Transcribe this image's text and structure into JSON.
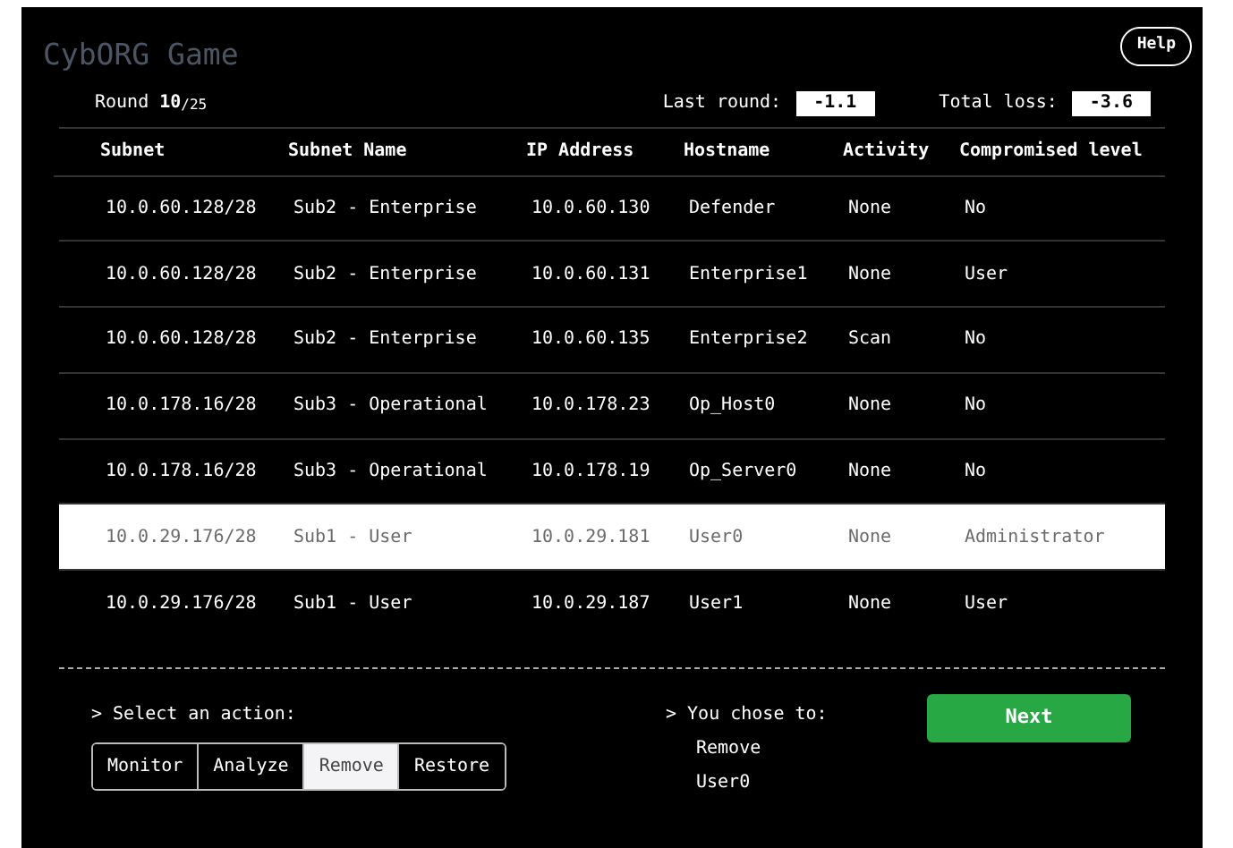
{
  "title": "CybORG Game",
  "help_button": "Help",
  "round": {
    "label": "Round",
    "current": "10",
    "total": "/25"
  },
  "scores": [
    {
      "label": "Last round:",
      "value": "-1.1"
    },
    {
      "label": "Total loss:",
      "value": "-3.6"
    }
  ],
  "table": {
    "columns": [
      "Subnet",
      "Subnet Name",
      "IP Address",
      "Hostname",
      "Activity",
      "Compromised level"
    ],
    "rows": [
      {
        "cells": [
          "10.0.60.128/28",
          "Sub2 - Enterprise",
          "10.0.60.130",
          "Defender",
          "None",
          "No"
        ],
        "selected": false
      },
      {
        "cells": [
          "10.0.60.128/28",
          "Sub2 - Enterprise",
          "10.0.60.131",
          "Enterprise1",
          "None",
          "User"
        ],
        "selected": false
      },
      {
        "cells": [
          "10.0.60.128/28",
          "Sub2 - Enterprise",
          "10.0.60.135",
          "Enterprise2",
          "Scan",
          "No"
        ],
        "selected": false
      },
      {
        "cells": [
          "10.0.178.16/28",
          "Sub3 - Operational",
          "10.0.178.23",
          "Op_Host0",
          "None",
          "No"
        ],
        "selected": false
      },
      {
        "cells": [
          "10.0.178.16/28",
          "Sub3 - Operational",
          "10.0.178.19",
          "Op_Server0",
          "None",
          "No"
        ],
        "selected": false
      },
      {
        "cells": [
          "10.0.29.176/28",
          "Sub1 - User",
          "10.0.29.181",
          "User0",
          "None",
          "Administrator"
        ],
        "selected": true
      },
      {
        "cells": [
          "10.0.29.176/28",
          "Sub1 - User",
          "10.0.29.187",
          "User1",
          "None",
          "User"
        ],
        "selected": false
      }
    ]
  },
  "action_prompt": "> Select an action:",
  "actions": [
    {
      "label": "Monitor",
      "selected": false
    },
    {
      "label": "Analyze",
      "selected": false
    },
    {
      "label": "Remove",
      "selected": true
    },
    {
      "label": "Restore",
      "selected": false
    }
  ],
  "choice_prompt": "> You chose to:",
  "choice_lines": [
    "Remove",
    "User0"
  ],
  "next_button": "Next"
}
